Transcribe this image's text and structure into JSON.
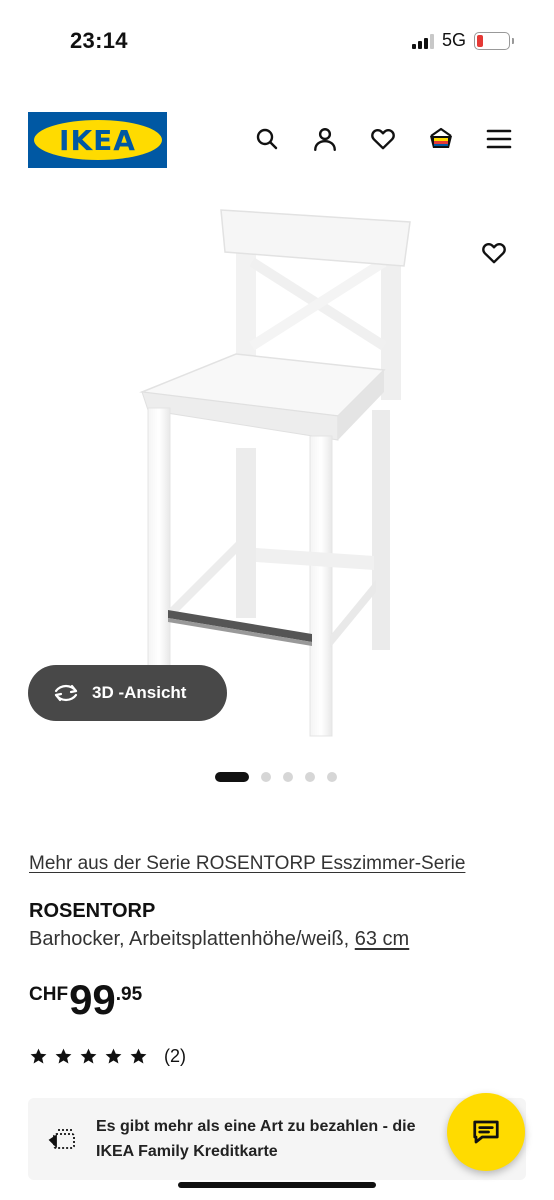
{
  "status_bar": {
    "time": "23:14",
    "network": "5G"
  },
  "header": {
    "logo_text": "IKEA",
    "icons": [
      "search-icon",
      "user-icon",
      "heart-icon",
      "shopping-bag-icon",
      "menu-icon"
    ]
  },
  "gallery": {
    "view_3d_label": "3D -Ansicht",
    "total_images": 5,
    "active_index": 0
  },
  "product": {
    "series_link": "Mehr aus der Serie ROSENTORP Esszimmer-Serie",
    "name": "ROSENTORP",
    "description": "Barhocker, Arbeitsplattenhöhe/weiß, ",
    "size": "63 cm",
    "price_currency": "CHF",
    "price_int": "99",
    "price_dec": ".95",
    "rating_stars": 5,
    "rating_count": "(2)"
  },
  "promo": {
    "text": "Es gibt mehr als eine Art zu bezahlen - die IKEA Family Kreditkarte"
  },
  "colors": {
    "ikea_blue": "#0058a3",
    "ikea_yellow": "#ffdb00",
    "button_dark": "#484848"
  }
}
